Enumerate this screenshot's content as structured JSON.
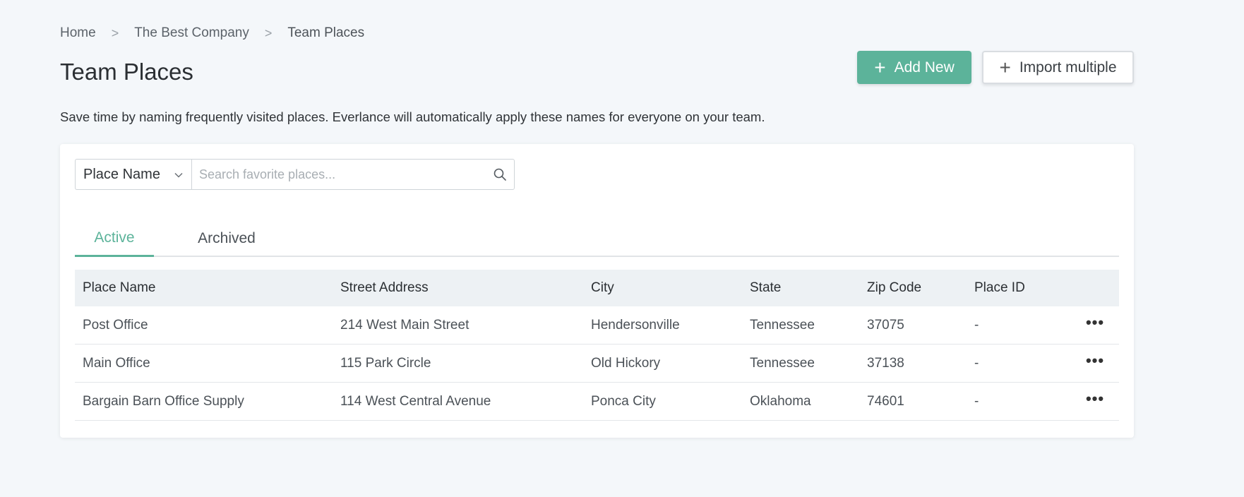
{
  "breadcrumb": {
    "items": [
      "Home",
      "The Best Company",
      "Team Places"
    ],
    "separator": ">"
  },
  "page": {
    "title": "Team Places",
    "description": "Save time by naming frequently visited places. Everlance will automatically apply these names for everyone on your team."
  },
  "actions": {
    "add_new": {
      "icon": "plus-icon",
      "label": "Add New"
    },
    "import_multiple": {
      "icon": "plus-icon",
      "label": "Import multiple"
    }
  },
  "search": {
    "filter_selected": "Place Name",
    "placeholder": "Search favorite places...",
    "value": ""
  },
  "tabs": [
    {
      "label": "Active",
      "active": true
    },
    {
      "label": "Archived",
      "active": false
    }
  ],
  "table": {
    "columns": [
      "Place Name",
      "Street Address",
      "City",
      "State",
      "Zip Code",
      "Place ID"
    ],
    "rows": [
      [
        "Post Office",
        "214 West Main Street",
        "Hendersonville",
        "Tennessee",
        "37075",
        "-"
      ],
      [
        "Main Office",
        "115 Park Circle",
        "Old Hickory",
        "Tennessee",
        "37138",
        "-"
      ],
      [
        "Bargain Barn Office Supply",
        "114 West Central Avenue",
        "Ponca City",
        "Oklahoma",
        "74601",
        "-"
      ]
    ],
    "row_menu_icon": "more-horizontal-icon",
    "row_menu_glyph": "•••"
  },
  "colors": {
    "accent": "#5cb39a",
    "background": "#f4f7fa",
    "table_header": "#edf1f4"
  }
}
